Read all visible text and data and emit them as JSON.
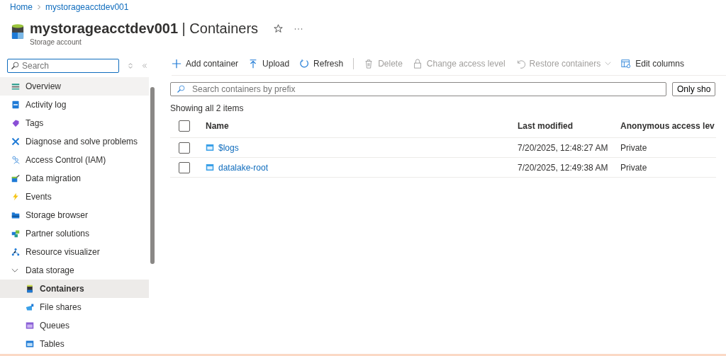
{
  "breadcrumb": [
    {
      "label": "Home"
    },
    {
      "label": "mystorageacctdev001"
    }
  ],
  "header": {
    "title": "**mystorageacctdev001** | Containers",
    "subtitle": "Storage account",
    "favorite": false
  },
  "sidebar": {
    "search": {
      "placeholder": "Search"
    },
    "items": [
      {
        "label": "Overview",
        "selected": false,
        "hovered": true
      },
      {
        "label": "Activity log",
        "selected": false
      },
      {
        "label": "Tags",
        "selected": false
      },
      {
        "label": "Diagnose and solve problems",
        "selected": false
      },
      {
        "label": "Access Control (IAM)",
        "selected": false
      },
      {
        "label": "Data migration",
        "selected": false
      },
      {
        "label": "Events",
        "selected": false
      },
      {
        "label": "Storage browser",
        "selected": false
      },
      {
        "label": "Partner solutions",
        "selected": false
      },
      {
        "label": "Resource visualizer",
        "selected": false
      },
      {
        "label": "Data storage",
        "selected": false,
        "expanded": true,
        "children": [
          {
            "label": "Containers",
            "selected": true
          },
          {
            "label": "File shares",
            "selected": false
          },
          {
            "label": "Queues",
            "selected": false
          },
          {
            "label": "Tables",
            "selected": false
          }
        ]
      }
    ]
  },
  "toolbar": [
    {
      "label": "Add container",
      "disabled": false
    },
    {
      "label": "Upload",
      "disabled": false
    },
    {
      "label": "Refresh",
      "disabled": false
    },
    {
      "label": "Delete",
      "disabled": true
    },
    {
      "label": "Change access level",
      "disabled": true
    },
    {
      "label": "Restore containers",
      "disabled": true,
      "dropdown": true
    },
    {
      "label": "Edit columns",
      "disabled": false
    }
  ],
  "filter": {
    "placeholder": "Search containers by prefix"
  },
  "filter_toggle": {
    "label": "Only sho"
  },
  "count": "Showing all 2 items",
  "table": {
    "columns": [
      "Name",
      "Last modified",
      "Anonymous access lev"
    ],
    "all_checked": false,
    "rows": [
      {
        "name": "$logs",
        "modified": "7/20/2025, 12:48:27 AM",
        "access": "Private",
        "checked": false
      },
      {
        "name": "datalake-root",
        "modified": "7/20/2025, 12:49:38 AM",
        "access": "Private",
        "checked": false
      }
    ]
  }
}
